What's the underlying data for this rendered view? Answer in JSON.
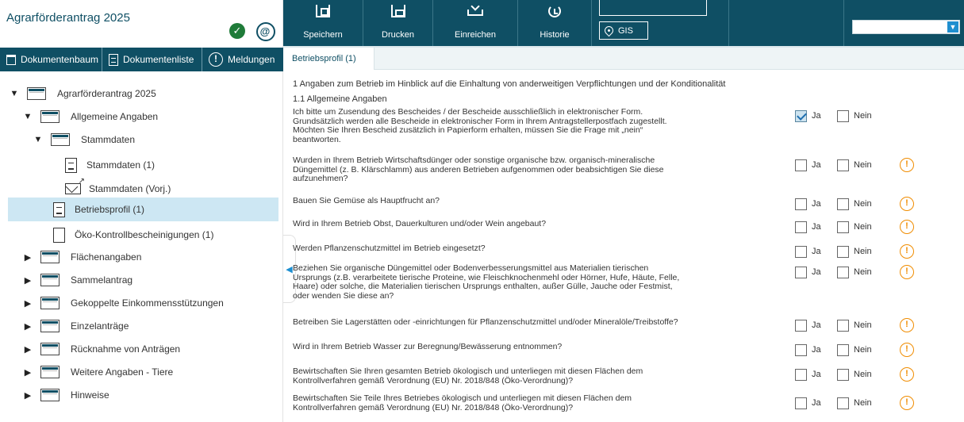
{
  "app": {
    "title": "Agrarförderantrag 2025",
    "colors": {
      "primary": "#0f4f64",
      "accent": "#1d8fd1",
      "ok": "#1f7b39",
      "warning": "#f08c00",
      "selected": "#cde7f3"
    },
    "status_icon": "check-circle-icon",
    "mail_icon": "at-sign-icon"
  },
  "left_tabs": [
    {
      "label": "Dokumentenbaum",
      "icon": "folder-icon"
    },
    {
      "label": "Dokumentenliste",
      "icon": "list-icon"
    },
    {
      "label": "Meldungen",
      "icon": "exclamation-circle-icon"
    }
  ],
  "tree": [
    {
      "label": "Agrarförderantrag 2025",
      "icon": "folder-icon",
      "toggle": "▼"
    },
    {
      "label": "Allgemeine Angaben",
      "icon": "folder-icon",
      "toggle": "▼"
    },
    {
      "label": "Stammdaten",
      "icon": "folder-icon",
      "toggle": "▼"
    },
    {
      "label": "Stammdaten (1)",
      "icon": "document-icon"
    },
    {
      "label": "Stammdaten (Vorj.)",
      "icon": "mail-icon"
    },
    {
      "label": "Betriebsprofil (1)",
      "icon": "document-icon",
      "selected": true
    },
    {
      "label": "Öko-Kontrollbescheinigungen (1)",
      "icon": "blank-document-icon"
    },
    {
      "label": "Flächenangaben",
      "icon": "folder-icon",
      "toggle": "▶"
    },
    {
      "label": "Sammelantrag",
      "icon": "folder-icon",
      "toggle": "▶"
    },
    {
      "label": "Gekoppelte Einkommensstützungen",
      "icon": "folder-icon",
      "toggle": "▶"
    },
    {
      "label": "Einzelanträge",
      "icon": "folder-icon",
      "toggle": "▶"
    },
    {
      "label": "Rücknahme von Anträgen",
      "icon": "folder-icon",
      "toggle": "▶"
    },
    {
      "label": "Weitere Angaben - Tiere",
      "icon": "folder-icon",
      "toggle": "▶"
    },
    {
      "label": "Hinweise",
      "icon": "folder-icon",
      "toggle": "▶"
    }
  ],
  "toolbar": {
    "save": "Speichern",
    "print": "Drucken",
    "submit": "Einreichen",
    "history": "Historie",
    "gis": "GIS",
    "dropdown_value": ""
  },
  "tab": {
    "label": "Betriebsprofil (1)"
  },
  "form": {
    "section_title": "1 Angaben zum Betrieb im Hinblick auf die Einhaltung von anderweitigen Verpflichtungen und der Konditionalität",
    "subsection_title": "1.1 Allgemeine Angaben",
    "yes_label": "Ja",
    "no_label": "Nein",
    "warning_icon": "exclamation-circle-icon",
    "questions": [
      {
        "lines": [
          "Ich bitte um Zusendung des Bescheides / der Bescheide ausschließlich in elektronischer Form.",
          "Grundsätzlich werden alle Bescheide in elektronischer Form in Ihrem Antragstellerpostfach zugestellt.",
          "Möchten Sie Ihren Bescheid zusätzlich in Papierform erhalten, müssen Sie die Frage mit „nein“",
          "beantworten."
        ],
        "ja": true,
        "nein": false,
        "warning": false
      },
      {
        "lines": [
          "Wurden in Ihrem Betrieb Wirtschaftsdünger oder sonstige organische bzw. organisch-mineralische",
          "Düngemittel (z. B. Klärschlamm) aus anderen Betrieben aufgenommen oder beabsichtigen Sie diese",
          "aufzunehmen?"
        ],
        "ja": false,
        "nein": false,
        "warning": true
      },
      {
        "lines": [
          "Bauen Sie Gemüse als Hauptfrucht an?"
        ],
        "ja": false,
        "nein": false,
        "warning": true
      },
      {
        "lines": [
          "Wird in Ihrem Betrieb Obst, Dauerkulturen und/oder Wein angebaut?"
        ],
        "ja": false,
        "nein": false,
        "warning": true
      },
      {
        "lines": [
          "Werden Pflanzenschutzmittel im Betrieb eingesetzt?"
        ],
        "ja": false,
        "nein": false,
        "warning": true
      },
      {
        "lines": [
          "Beziehen Sie organische Düngemittel oder Bodenverbesserungsmittel aus Materialien tierischen",
          "Ursprungs (z.B. verarbeitete tierische Proteine, wie Fleischknochenmehl oder Hörner, Hufe, Häute, Felle,",
          "Haare) oder solche, die Materialien tierischen Ursprungs enthalten, außer Gülle, Jauche oder Festmist,",
          "oder wenden Sie diese an?"
        ],
        "ja": false,
        "nein": false,
        "warning": true
      },
      {
        "lines": [
          "Betreiben Sie Lagerstätten oder -einrichtungen für Pflanzenschutzmittel und/oder Mineralöle/Treibstoffe?"
        ],
        "ja": false,
        "nein": false,
        "warning": true
      },
      {
        "lines": [
          "Wird in Ihrem Betrieb Wasser zur Beregnung/Bewässerung entnommen?"
        ],
        "ja": false,
        "nein": false,
        "warning": true
      },
      {
        "lines": [
          "Bewirtschaften Sie Ihren gesamten Betrieb ökologisch und unterliegen mit diesen Flächen dem",
          "Kontrollverfahren gemäß Verordnung (EU) Nr. 2018/848 (Öko-Verordnung)?"
        ],
        "ja": false,
        "nein": false,
        "warning": true
      },
      {
        "lines": [
          "Bewirtschaften Sie Teile Ihres Betriebes ökologisch und unterliegen mit diesen Flächen dem",
          "Kontrollverfahren gemäß Verordnung (EU) Nr. 2018/848 (Öko-Verordnung)?"
        ],
        "ja": false,
        "nein": false,
        "warning": true
      }
    ]
  }
}
